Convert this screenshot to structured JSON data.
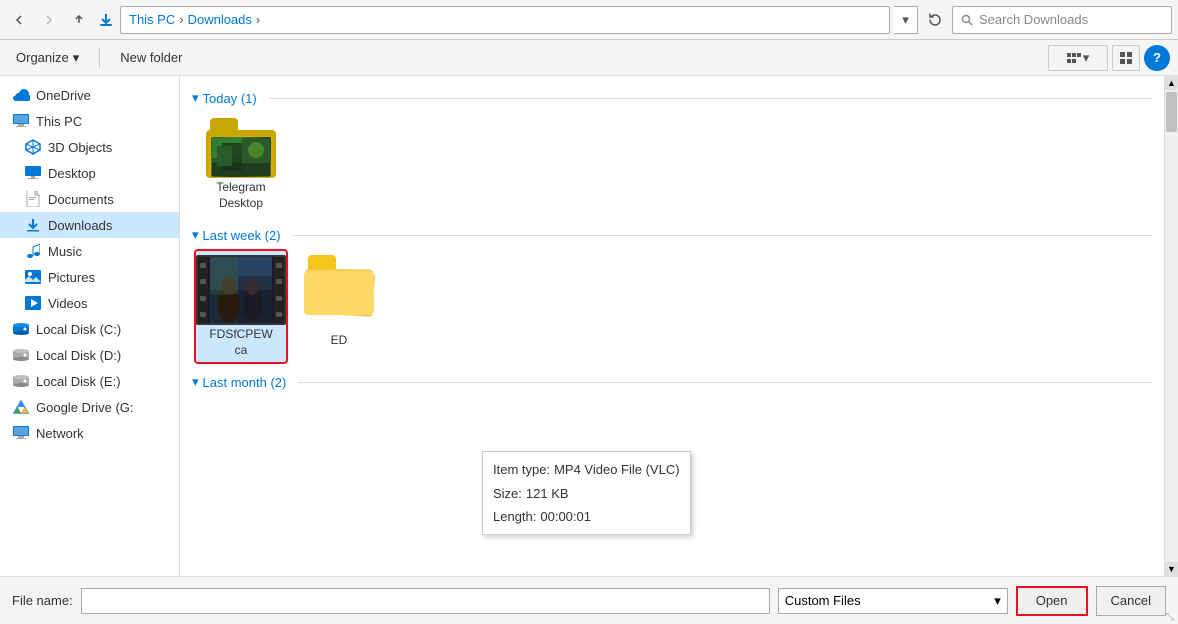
{
  "window": {
    "title": "Downloads"
  },
  "addressBar": {
    "backDisabled": false,
    "forwardDisabled": true,
    "upTooltip": "Up to This PC",
    "pathParts": [
      "This PC",
      "Downloads"
    ],
    "searchPlaceholder": "Search Downloads",
    "refreshTitle": "Refresh"
  },
  "toolbar": {
    "organizeLabel": "Organize",
    "newFolderLabel": "New folder",
    "viewLabel": "View",
    "helpLabel": "?"
  },
  "sidebar": {
    "items": [
      {
        "id": "onedrive",
        "label": "OneDrive",
        "icon": "cloud"
      },
      {
        "id": "thispc",
        "label": "This PC",
        "icon": "computer"
      },
      {
        "id": "3dobjects",
        "label": "3D Objects",
        "icon": "cube"
      },
      {
        "id": "desktop",
        "label": "Desktop",
        "icon": "desktop"
      },
      {
        "id": "documents",
        "label": "Documents",
        "icon": "document"
      },
      {
        "id": "downloads",
        "label": "Downloads",
        "icon": "download",
        "selected": true
      },
      {
        "id": "music",
        "label": "Music",
        "icon": "music"
      },
      {
        "id": "pictures",
        "label": "Pictures",
        "icon": "pictures"
      },
      {
        "id": "videos",
        "label": "Videos",
        "icon": "videos"
      },
      {
        "id": "localdiskc",
        "label": "Local Disk (C:)",
        "icon": "disk"
      },
      {
        "id": "localdiskd",
        "label": "Local Disk (D:)",
        "icon": "disk"
      },
      {
        "id": "localdiské",
        "label": "Local Disk (E:)",
        "icon": "disk"
      },
      {
        "id": "googledrive",
        "label": "Google Drive (G:",
        "icon": "cloud"
      },
      {
        "id": "network",
        "label": "Network",
        "icon": "network"
      }
    ]
  },
  "fileArea": {
    "groups": [
      {
        "id": "today",
        "label": "Today (1)",
        "collapsed": false,
        "files": [
          {
            "id": "telegram",
            "name": "Telegram\nDesktop",
            "type": "folder-image",
            "selected": false
          }
        ]
      },
      {
        "id": "lastweek",
        "label": "Last week (2)",
        "collapsed": false,
        "files": [
          {
            "id": "fdsfcpewca",
            "name": "FDSfCPEW\nca",
            "type": "video",
            "selected": true
          },
          {
            "id": "ed",
            "name": "\nED",
            "type": "folder-stacked",
            "selected": false
          }
        ]
      },
      {
        "id": "lastmonth",
        "label": "Last month (2)",
        "collapsed": false,
        "files": []
      }
    ],
    "tooltip": {
      "visible": true,
      "itemType": "MP4 Video File (VLC)",
      "size": "121 KB",
      "length": "00:00:01"
    }
  },
  "bottomBar": {
    "fileNameLabel": "File name:",
    "fileNameValue": "",
    "fileTypeLabel": "Custom Files",
    "openLabel": "Open",
    "cancelLabel": "Cancel"
  }
}
